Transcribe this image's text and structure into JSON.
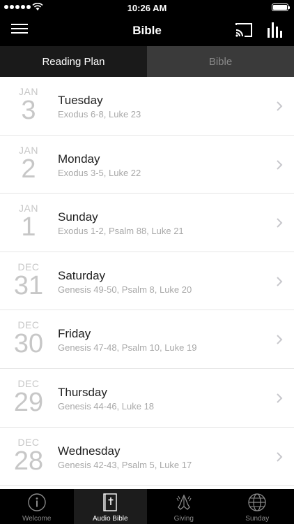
{
  "status_bar": {
    "time": "10:26 AM"
  },
  "nav": {
    "title": "Bible"
  },
  "tabs": [
    {
      "label": "Reading Plan",
      "active": true
    },
    {
      "label": "Bible",
      "active": false
    }
  ],
  "plan": [
    {
      "month": "JAN",
      "day": "3",
      "weekday": "Tuesday",
      "readings": "Exodus 6-8, Luke 23"
    },
    {
      "month": "JAN",
      "day": "2",
      "weekday": "Monday",
      "readings": "Exodus 3-5, Luke 22"
    },
    {
      "month": "JAN",
      "day": "1",
      "weekday": "Sunday",
      "readings": "Exodus 1-2, Psalm 88, Luke 21"
    },
    {
      "month": "DEC",
      "day": "31",
      "weekday": "Saturday",
      "readings": "Genesis 49-50, Psalm 8, Luke 20"
    },
    {
      "month": "DEC",
      "day": "30",
      "weekday": "Friday",
      "readings": "Genesis 47-48, Psalm 10, Luke 19"
    },
    {
      "month": "DEC",
      "day": "29",
      "weekday": "Thursday",
      "readings": "Genesis 44-46, Luke 18"
    },
    {
      "month": "DEC",
      "day": "28",
      "weekday": "Wednesday",
      "readings": "Genesis 42-43, Psalm 5, Luke 17"
    }
  ],
  "tab_bar": [
    {
      "label": "Welcome",
      "icon": "info-icon",
      "selected": false
    },
    {
      "label": "Audio Bible",
      "icon": "bible-book-icon",
      "selected": true
    },
    {
      "label": "Giving",
      "icon": "praying-hands-icon",
      "selected": false
    },
    {
      "label": "Sunday",
      "icon": "globe-icon",
      "selected": false
    }
  ]
}
